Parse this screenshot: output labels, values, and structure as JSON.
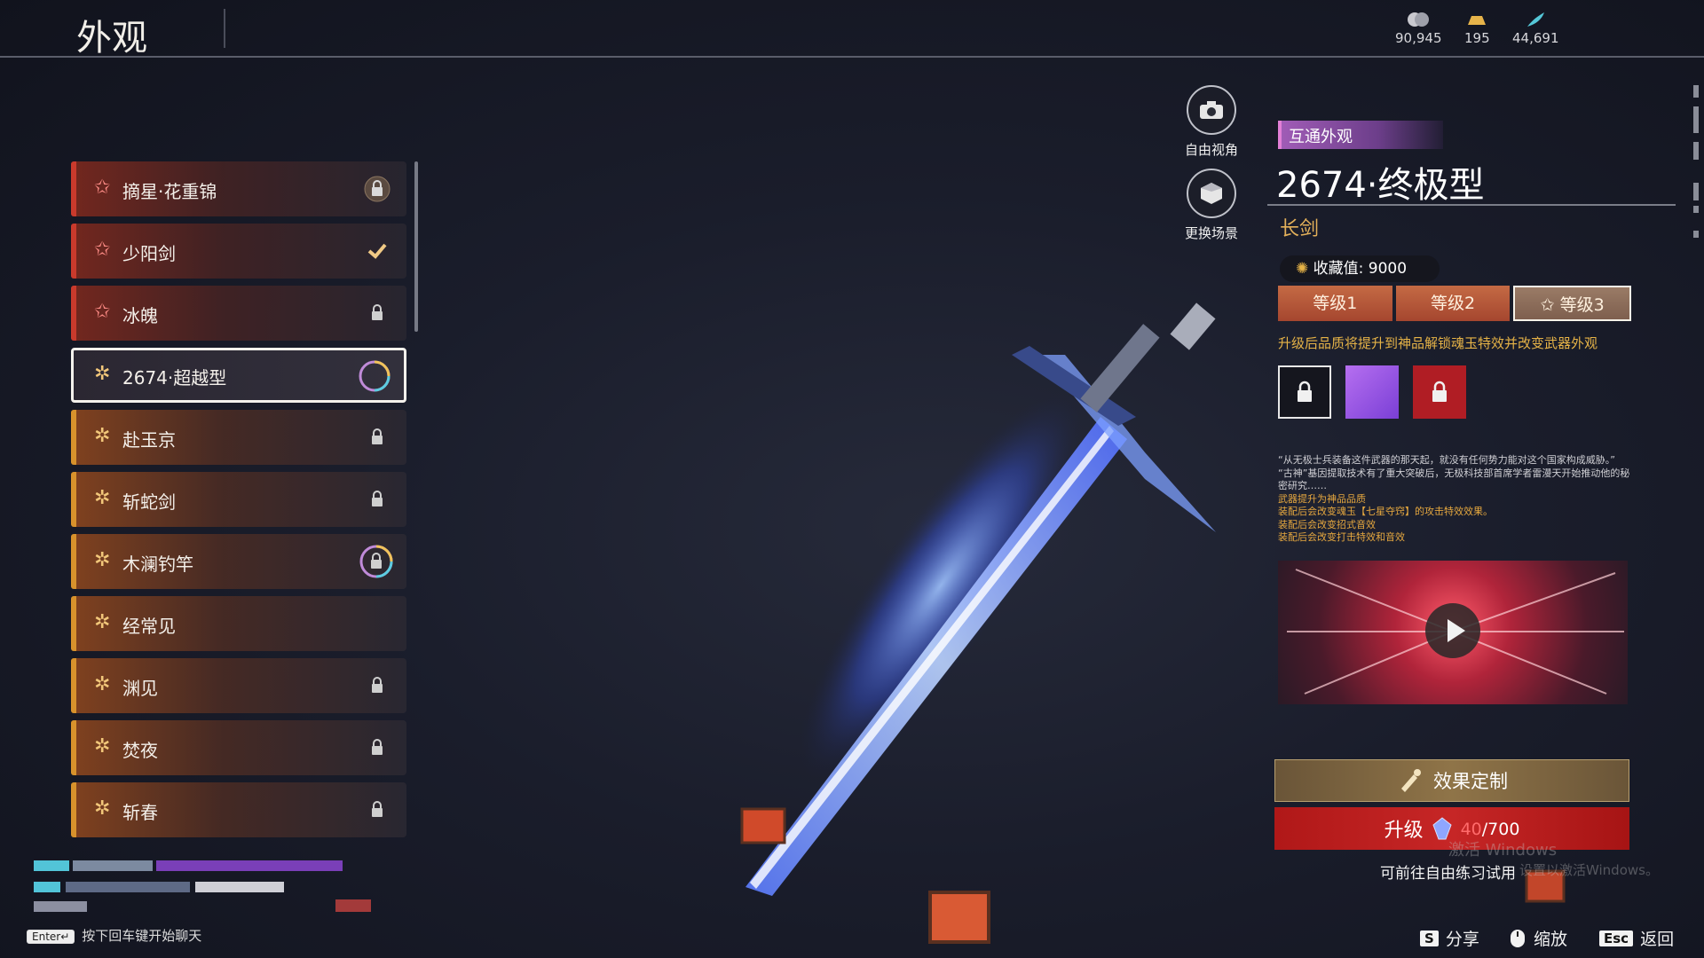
{
  "header": {
    "title": "外观"
  },
  "currencies": [
    {
      "icon": "coins-icon",
      "value": "90,945"
    },
    {
      "icon": "gold-ingot-icon",
      "value": "195"
    },
    {
      "icon": "feather-icon",
      "value": "44,691"
    }
  ],
  "list": {
    "items": [
      {
        "label": "摘星·花重锦",
        "rarity": "red",
        "status": "locked-badge"
      },
      {
        "label": "少阳剑",
        "rarity": "red",
        "status": "equipped"
      },
      {
        "label": "冰魄",
        "rarity": "red",
        "status": "locked"
      },
      {
        "label": "2674·超越型",
        "rarity": "gold",
        "status": "ring",
        "selected": true
      },
      {
        "label": "赴玉京",
        "rarity": "gold",
        "status": "locked"
      },
      {
        "label": "斩蛇剑",
        "rarity": "gold",
        "status": "locked"
      },
      {
        "label": "木澜钓竿",
        "rarity": "gold",
        "status": "ring-locked"
      },
      {
        "label": "经常见",
        "rarity": "gold",
        "status": "none"
      },
      {
        "label": "渊见",
        "rarity": "gold",
        "status": "locked"
      },
      {
        "label": "焚夜",
        "rarity": "gold",
        "status": "locked"
      },
      {
        "label": "斩春",
        "rarity": "gold",
        "status": "locked"
      }
    ]
  },
  "chat": {
    "enter_key": "Enter↵",
    "hint": "按下回车键开始聊天"
  },
  "view_controls": {
    "free_view": "自由视角",
    "change_scene": "更换场景"
  },
  "detail": {
    "tag": "互通外观",
    "name": "2674·终极型",
    "weapon_type": "长剑",
    "collection_label": "收藏值:",
    "collection_value": "9000",
    "levels": [
      "等级1",
      "等级2",
      "等级3"
    ],
    "active_level": 2,
    "upgrade_note": "升级后品质将提升到神品解锁魂玉特效并改变武器外观",
    "lore_lines": [
      "“从无极士兵装备这件武器的那天起，就没有任何势力能对这个国家构成威胁。”",
      "“古神”基因提取技术有了重大突破后，无极科技部首席学者雷漫天开始推动他的秘密研究……"
    ],
    "effect_lines": [
      "武器提升为神品品质",
      "装配后会改变魂玉【七星夺窍】的攻击特效效果。",
      "装配后会改变招式音效",
      "装配后会改变打击特效和音效"
    ],
    "effect_button": "效果定制",
    "upgrade_button": "升级",
    "upgrade_current": "40",
    "upgrade_total": "/700",
    "trial_text": "可前往自由练习试用"
  },
  "watermark": {
    "line1": "激活 Windows",
    "line2": "设置以激活Windows。"
  },
  "hints": [
    {
      "key": "S",
      "label": "分享"
    },
    {
      "key": "",
      "label": "缩放"
    },
    {
      "key": "Esc",
      "label": "返回"
    }
  ],
  "colors": {
    "red_rarity": "#c93a2c",
    "gold_rarity": "#d8922c",
    "accent_gold": "#e3b05a",
    "upgrade_red": "#c62626",
    "tag_purple": "#a05cb6"
  }
}
